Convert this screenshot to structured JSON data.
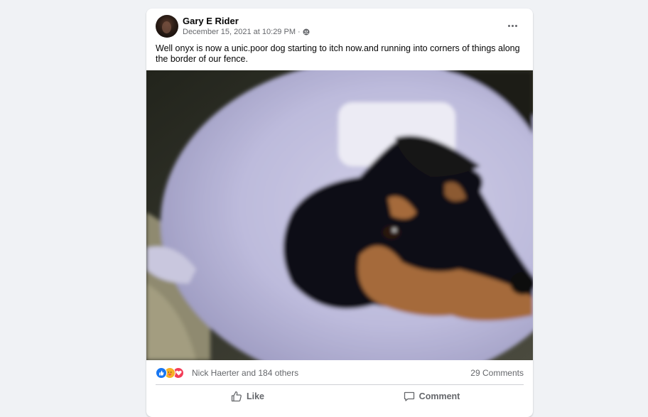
{
  "post": {
    "author": "Gary E Rider",
    "timestamp": "December 15, 2021 at 10:29 PM",
    "separator": "·",
    "privacy_icon": "friends-icon",
    "text": "Well onyx is now a unic.poor dog starting to itch now.and running into corners of things along the border of our fence.",
    "photo_icon": "dog-in-cone-photo"
  },
  "menu": {
    "icon": "more-options-icon"
  },
  "reactions": {
    "icons": [
      "like-reaction-icon",
      "care-reaction-icon",
      "love-reaction-icon"
    ],
    "names": "Nick Haerter and 184 others",
    "comments": "29 Comments"
  },
  "actions": {
    "like_label": "Like",
    "comment_label": "Comment"
  },
  "colors": {
    "like_blue": "#1877f2",
    "love_red": "#f33e58",
    "care_yellow": "#f7b125",
    "secondary_text": "#65676b"
  }
}
